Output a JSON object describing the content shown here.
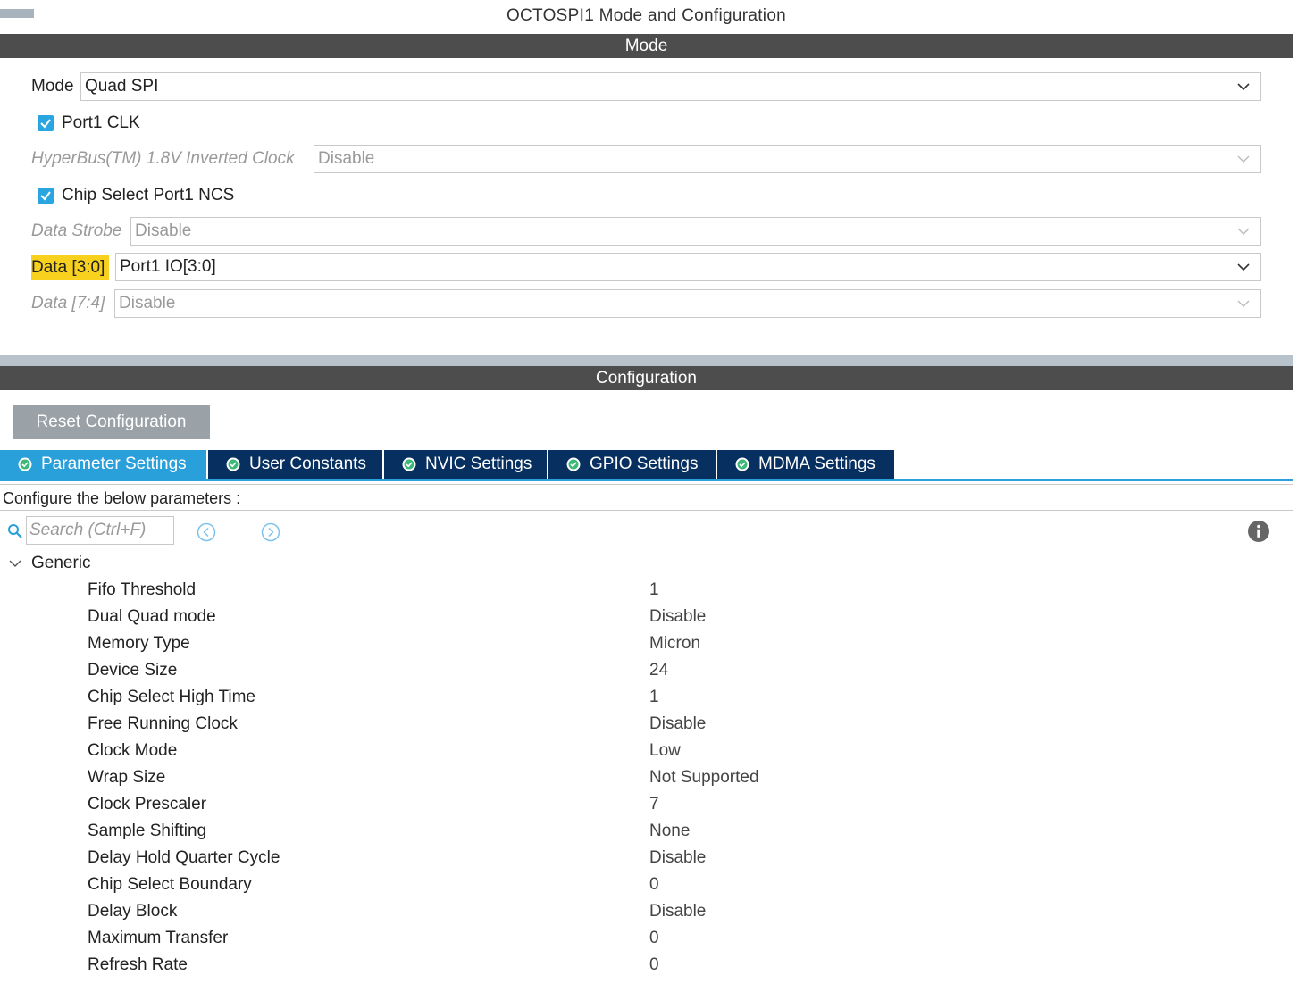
{
  "window": {
    "title": "OCTOSPI1 Mode and Configuration"
  },
  "mode_section": {
    "header": "Mode",
    "mode": {
      "label": "Mode",
      "value": "Quad SPI"
    },
    "port1_clk": {
      "label": "Port1 CLK",
      "checked": true
    },
    "hyperbus": {
      "label": "HyperBus(TM) 1.8V Inverted Clock",
      "value": "Disable"
    },
    "chip_select": {
      "label": "Chip Select Port1 NCS",
      "checked": true
    },
    "data_strobe": {
      "label": "Data Strobe",
      "value": "Disable"
    },
    "data_3_0": {
      "label": "Data [3:0]",
      "value": "Port1 IO[3:0]"
    },
    "data_7_4": {
      "label": "Data [7:4]",
      "value": "Disable"
    }
  },
  "config_section": {
    "header": "Configuration",
    "reset_label": "Reset Configuration",
    "tabs": [
      {
        "label": "Parameter Settings",
        "active": true
      },
      {
        "label": "User Constants",
        "active": false
      },
      {
        "label": "NVIC Settings",
        "active": false
      },
      {
        "label": "GPIO Settings",
        "active": false
      },
      {
        "label": "MDMA Settings",
        "active": false
      }
    ],
    "configure_text": "Configure the below parameters :",
    "search_placeholder": "Search (Ctrl+F)",
    "group": "Generic",
    "params": [
      {
        "name": "Fifo Threshold",
        "value": "1"
      },
      {
        "name": "Dual Quad mode",
        "value": "Disable"
      },
      {
        "name": "Memory Type",
        "value": "Micron"
      },
      {
        "name": "Device Size",
        "value": "24"
      },
      {
        "name": "Chip Select High Time",
        "value": "1"
      },
      {
        "name": "Free Running Clock",
        "value": "Disable"
      },
      {
        "name": "Clock Mode",
        "value": "Low"
      },
      {
        "name": "Wrap Size",
        "value": "Not Supported"
      },
      {
        "name": "Clock Prescaler",
        "value": "7"
      },
      {
        "name": "Sample Shifting",
        "value": "None"
      },
      {
        "name": "Delay Hold Quarter Cycle",
        "value": "Disable"
      },
      {
        "name": "Chip Select Boundary",
        "value": "0"
      },
      {
        "name": "Delay Block",
        "value": "Disable"
      },
      {
        "name": "Maximum Transfer",
        "value": "0"
      },
      {
        "name": "Refresh Rate",
        "value": "0"
      }
    ]
  },
  "colors": {
    "header_bar": "#4d4d4d",
    "active_tab": "#2aa0da",
    "inactive_tab": "#072f5f",
    "highlight": "#f7d11e",
    "checkbox": "#2aa5e0"
  },
  "icons": [
    "chevron-down-icon",
    "checkbox-checked-icon",
    "check-circle-icon",
    "search-icon",
    "arrow-left-circle-icon",
    "arrow-right-circle-icon",
    "info-icon",
    "collapse-chevron-icon"
  ]
}
